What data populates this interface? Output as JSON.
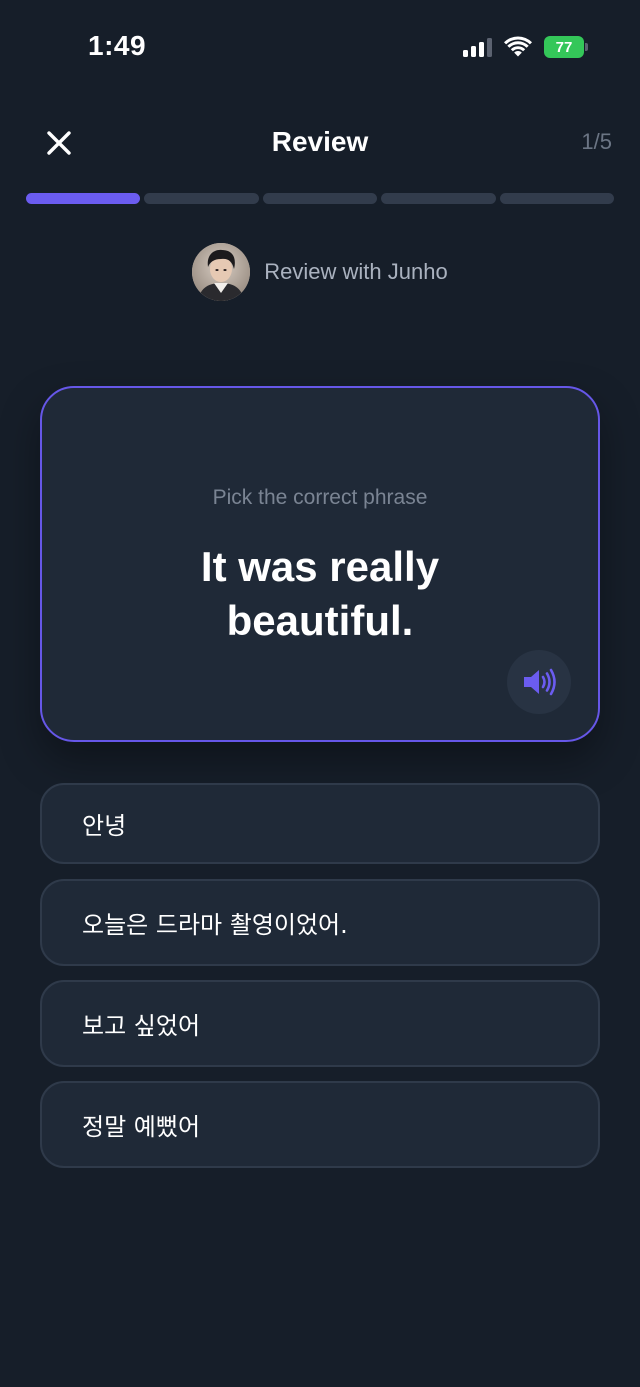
{
  "status_bar": {
    "time": "1:49",
    "battery_level": "77",
    "battery_color": "#34c759"
  },
  "header": {
    "close_icon": "close-icon",
    "title": "Review",
    "counter": "1/5"
  },
  "progress": {
    "current": 1,
    "total": 5,
    "active_color": "#6b5cf0",
    "inactive_color": "#323c4c"
  },
  "tutor": {
    "label": "Review with Junho",
    "avatar": "avatar-photo"
  },
  "prompt": {
    "instruction": "Pick the correct phrase",
    "phrase": "It was really beautiful.",
    "audio_icon": "speaker-icon",
    "accent_color": "#6657e8"
  },
  "options": [
    {
      "label": "안녕"
    },
    {
      "label": "오늘은 드라마 촬영이었어."
    },
    {
      "label": "보고 싶었어"
    },
    {
      "label": "정말 예뻤어"
    }
  ]
}
